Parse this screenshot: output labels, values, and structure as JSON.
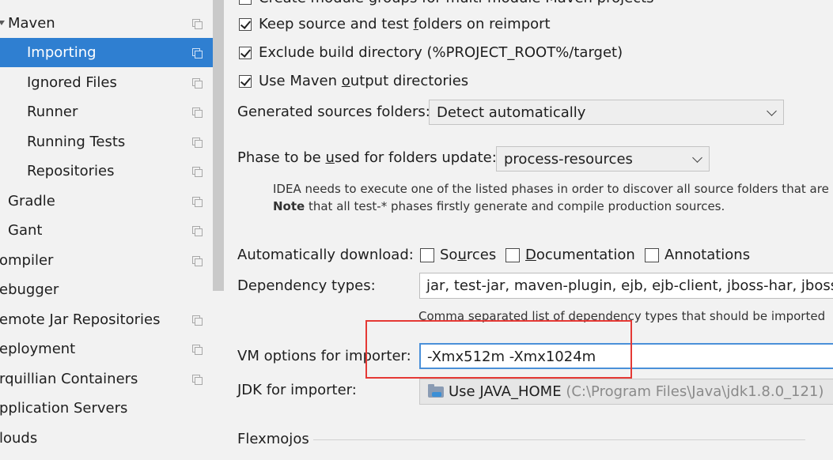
{
  "tree": {
    "items": [
      {
        "label": "Maven",
        "expanded": true
      },
      {
        "label": "Importing",
        "selected": true
      },
      {
        "label": "Ignored Files"
      },
      {
        "label": "Runner"
      },
      {
        "label": "Running Tests"
      },
      {
        "label": "Repositories"
      },
      {
        "label": "Gradle"
      },
      {
        "label": "Gant"
      },
      {
        "label": "ompiler"
      },
      {
        "label": "ebugger"
      },
      {
        "label": "emote Jar Repositories"
      },
      {
        "label": "eployment"
      },
      {
        "label": "rquillian Containers"
      },
      {
        "label": "pplication Servers"
      },
      {
        "label": "louds"
      }
    ],
    "selected_color": "#2f7fd1"
  },
  "settings": {
    "top_clipped_text": "Create module groups for multi-module Maven projects",
    "keep_source_prefix": "Keep source and test ",
    "keep_source_mnemonic": "f",
    "keep_source_suffix": "olders on reimport",
    "exclude_build": "Exclude build directory (%PROJECT_ROOT%/target)",
    "use_output_prefix": "Use Maven ",
    "use_output_mnemonic": "o",
    "use_output_suffix": "utput directories",
    "generated_label": "Generated sources folders:",
    "generated_value": "Detect automatically",
    "phase_label_prefix": "Phase to be ",
    "phase_label_mnemonic": "u",
    "phase_label_suffix": "sed for folders update:",
    "phase_value": "process-resources",
    "note_line1": "IDEA needs to execute one of the listed phases in order to discover all source folders that are",
    "note_bold": "Note",
    "note_line2_rest": " that all test-* phases firstly generate and compile production sources.",
    "auto_download_label": "Automatically download:",
    "sources_prefix": "So",
    "sources_mnemonic": "u",
    "sources_suffix": "rces",
    "documentation_mnemonic": "D",
    "documentation_suffix": "ocumentation",
    "annotations": "Annotations",
    "dependency_label": "Dependency types:",
    "dependency_value": "jar, test-jar, maven-plugin, ejb, ejb-client, jboss-har, jboss-sar",
    "dependency_hint": "Comma separated list of dependency types that should be imported",
    "vm_label": "VM options for importer:",
    "vm_value": "-Xmx512m -Xmx1024m",
    "jdk_label": "JDK for importer:",
    "jdk_value": "Use JAVA_HOME",
    "jdk_path": "(C:\\Program Files\\Java\\jdk1.8.0_121)",
    "flexmojos": "Flexmojos",
    "checkboxes": {
      "keep_source": true,
      "exclude_build": true,
      "use_output": true,
      "sources": false,
      "documentation": false,
      "annotations": false
    },
    "highlight_color": "#e53935"
  }
}
